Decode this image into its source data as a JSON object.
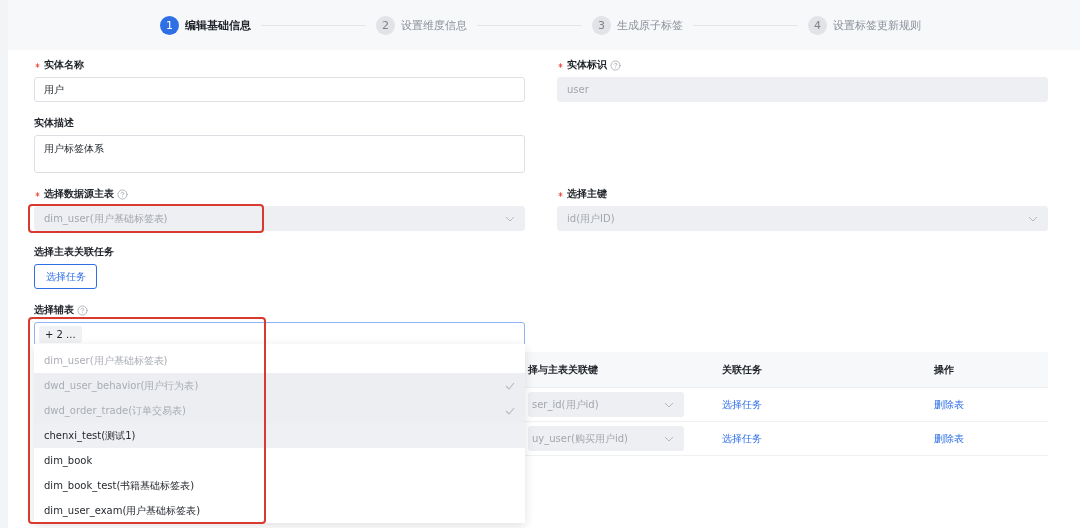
{
  "steps": [
    {
      "number": "1",
      "label": "编辑基础信息",
      "selected": true
    },
    {
      "number": "2",
      "label": "设置维度信息",
      "selected": false
    },
    {
      "number": "3",
      "label": "生成原子标签",
      "selected": false
    },
    {
      "number": "4",
      "label": "设置标签更新规则",
      "selected": false
    }
  ],
  "form": {
    "entity_name": {
      "label": "实体名称",
      "required": true,
      "value": "用户",
      "disabled": false
    },
    "entity_id": {
      "label": "实体标识",
      "required": true,
      "help": true,
      "value": "user",
      "disabled": true
    },
    "description": {
      "label": "实体描述",
      "value": "用户标签体系"
    },
    "main_table": {
      "label": "选择数据源主表",
      "required": true,
      "help": true,
      "value": "dim_user(用户基础标签表)",
      "disabled": true,
      "annotated": true
    },
    "primary_key": {
      "label": "选择主键",
      "required": true,
      "value": "id(用户ID)",
      "disabled": true
    },
    "main_task": {
      "label": "选择主表关联任务",
      "button": "选择任务"
    },
    "aux_tables": {
      "label": "选择辅表",
      "help": true,
      "tag": "+ 2 ...",
      "focused": true,
      "annotated": true,
      "options": [
        {
          "label": "dim_user(用户基础标签表)",
          "disabled": true,
          "selected": false
        },
        {
          "label": "dwd_user_behavior(用户行为表)",
          "disabled": true,
          "selected": true
        },
        {
          "label": "dwd_order_trade(订单交易表)",
          "disabled": true,
          "selected": true
        },
        {
          "label": "chenxi_test(测试1)",
          "disabled": false,
          "selected": false,
          "hovered": true
        },
        {
          "label": "dim_book",
          "disabled": false,
          "selected": false
        },
        {
          "label": "dim_book_test(书籍基础标签表)",
          "disabled": false,
          "selected": false
        },
        {
          "label": "dim_user_exam(用户基础标签表)",
          "disabled": false,
          "selected": false
        }
      ]
    }
  },
  "table": {
    "columns": [
      "择与主表关联键",
      "关联任务",
      "操作"
    ],
    "rows": [
      {
        "key": "ser_id(用户id)",
        "task": "选择任务",
        "action": "删除表"
      },
      {
        "key": "uy_user(购买用户id)",
        "task": "选择任务",
        "action": "删除表"
      }
    ]
  }
}
